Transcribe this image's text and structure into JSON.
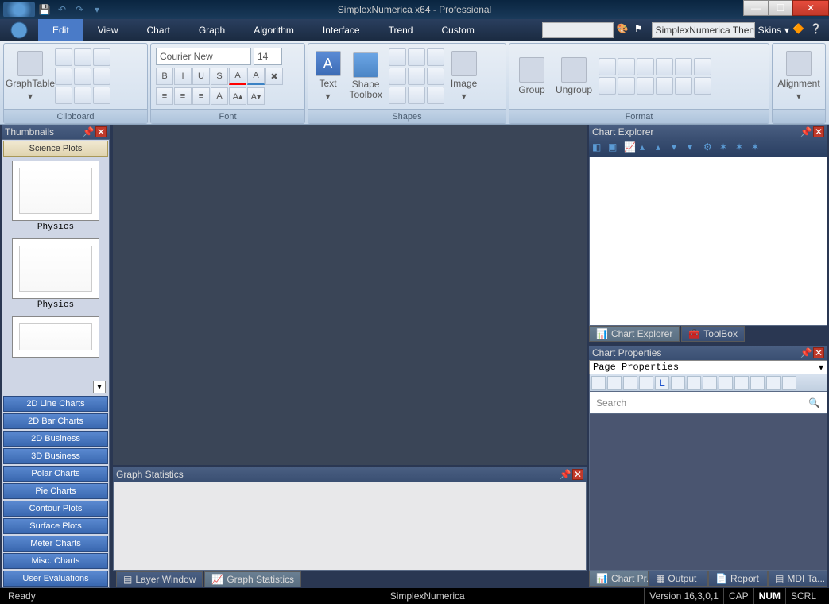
{
  "title": "SimplexNumerica x64 - Professional",
  "menu": {
    "tabs": [
      "Edit",
      "View",
      "Chart",
      "Graph",
      "Algorithm",
      "Interface",
      "Trend",
      "Custom"
    ],
    "active": 0,
    "theme_label": "SimplexNumerica Them",
    "skins_label": "Skins"
  },
  "ribbon": {
    "clipboard": {
      "label": "Clipboard",
      "graphtable": "GraphTable"
    },
    "font": {
      "label": "Font",
      "name": "Courier New",
      "size": "14",
      "buttons": [
        "B",
        "I",
        "U",
        "S"
      ]
    },
    "shapes": {
      "label": "Shapes",
      "text": "Text",
      "toolbox": "Shape\nToolbox",
      "image": "Image"
    },
    "format": {
      "label": "Format",
      "group": "Group",
      "ungroup": "Ungroup",
      "alignment": "Alignment"
    }
  },
  "thumbnails": {
    "title": "Thumbnails",
    "active_category": "Science Plots",
    "items": [
      {
        "caption": "Physics"
      },
      {
        "caption": "Physics"
      },
      {
        "caption": ""
      }
    ],
    "categories": [
      "2D Line Charts",
      "2D Bar Charts",
      "2D Business",
      "3D Business",
      "Polar Charts",
      "Pie Charts",
      "Contour Plots",
      "Surface Plots",
      "Meter Charts",
      "Misc. Charts",
      "User Evaluations"
    ]
  },
  "graphstats": {
    "title": "Graph Statistics",
    "tabs": [
      "Layer Window",
      "Graph Statistics"
    ],
    "active_tab": 1
  },
  "chart_explorer": {
    "title": "Chart Explorer",
    "tabs": [
      "Chart Explorer",
      "ToolBox"
    ],
    "active_tab": 0
  },
  "chart_props": {
    "title": "Chart Properties",
    "combo": "Page Properties",
    "search_placeholder": "Search",
    "tabs": [
      "Chart Pr...",
      "Output",
      "Report",
      "MDI Ta..."
    ],
    "active_tab": 0
  },
  "status": {
    "ready": "Ready",
    "app": "SimplexNumerica",
    "version": "Version 16,3,0,1",
    "cap": "CAP",
    "num": "NUM",
    "scrl": "SCRL"
  }
}
